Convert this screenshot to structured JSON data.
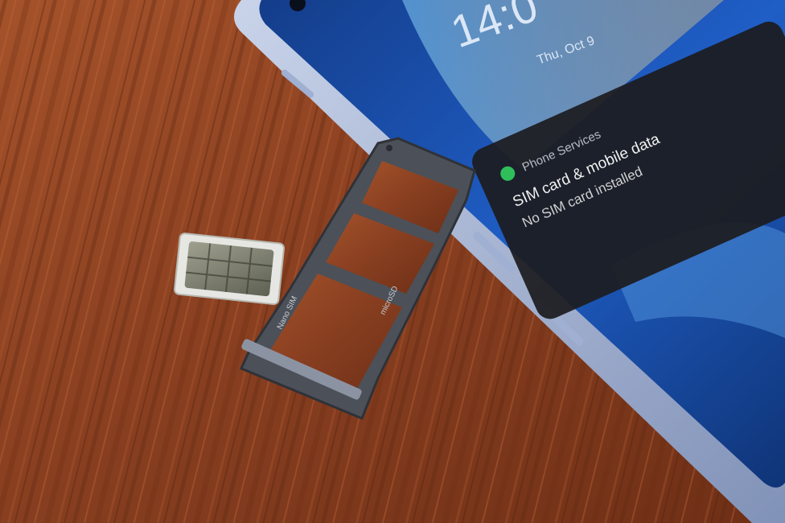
{
  "lockscreen": {
    "clock": "14:0",
    "date": "Thu, Oct 9"
  },
  "notification": {
    "app_name": "Phone Services",
    "title": "SIM card & mobile data",
    "body": "No SIM card installed"
  },
  "sim_tray": {
    "label_microsd": "microSD",
    "label_nano": "Nano SIM",
    "metal_color": "#4c5058"
  },
  "colors": {
    "wood": "#8a4523",
    "phone_frame": "#a9b8d6",
    "screen": "#1b4fb0",
    "notif_bg": "#1c1c1f",
    "notif_icon": "#2fbf5a"
  }
}
